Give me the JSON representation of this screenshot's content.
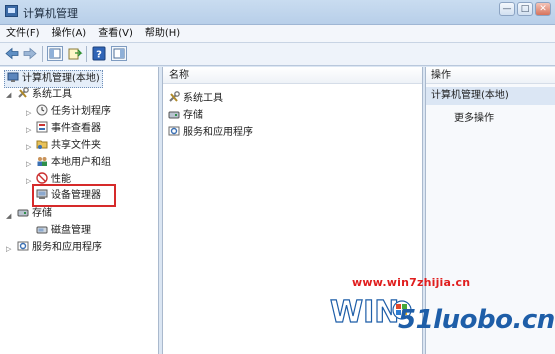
{
  "window": {
    "title": "计算机管理",
    "controls": [
      "—",
      "□",
      "✕"
    ]
  },
  "menu": [
    "文件(F)",
    "操作(A)",
    "查看(V)",
    "帮助(H)"
  ],
  "toolbar": {
    "icons": [
      "back-arrow-icon",
      "forward-arrow-icon",
      "show-tree-icon",
      "export-list-icon",
      "help-icon",
      "show-action-pane-icon"
    ]
  },
  "tree": {
    "root": "计算机管理(本地)",
    "system_tools": "系统工具",
    "task_scheduler": "任务计划程序",
    "event_viewer": "事件查看器",
    "shared_folders": "共享文件夹",
    "local_users": "本地用户和组",
    "performance": "性能",
    "device_manager": "设备管理器",
    "storage": "存储",
    "disk_management": "磁盘管理",
    "services": "服务和应用程序"
  },
  "list": {
    "column_name": "名称",
    "items": [
      "系统工具",
      "存储",
      "服务和应用程序"
    ]
  },
  "actions": {
    "header": "操作",
    "section": "计算机管理(本地)",
    "more": "更多操作"
  },
  "watermark": {
    "url": "www.win7zhijia.cn",
    "site": "51luobo.cn"
  },
  "colors": {
    "highlight_box": "#d62a2a",
    "watermark_red": "#e01e1e",
    "watermark_blue": "#1e5ea8"
  }
}
